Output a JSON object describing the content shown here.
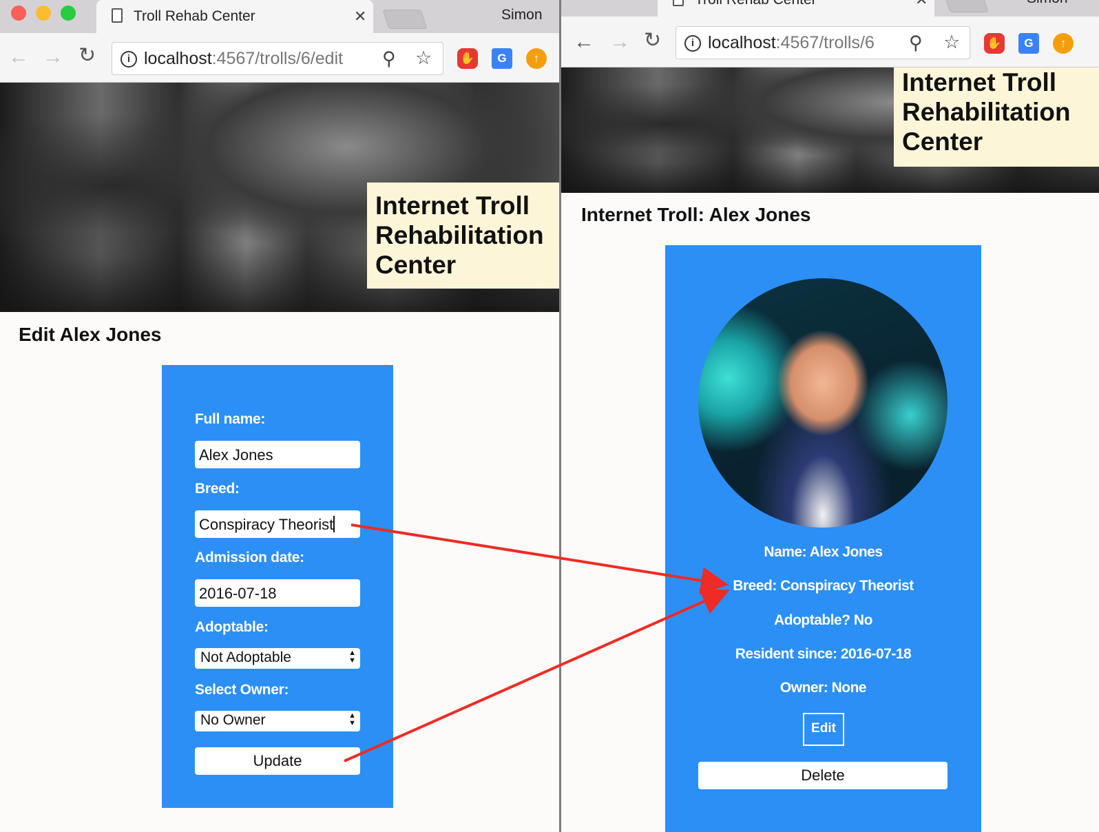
{
  "left_window": {
    "tab_title": "Troll Rehab Center",
    "profile_name": "Simon",
    "url_host": "localhost",
    "url_path": ":4567/trolls/6/edit",
    "brand_lines": [
      "Internet Troll",
      "Rehabilitation",
      "Center"
    ],
    "page_title": "Edit Alex Jones",
    "form": {
      "full_name_label": "Full name:",
      "full_name_value": "Alex Jones",
      "breed_label": "Breed:",
      "breed_value": "Conspiracy Theorist",
      "admission_label": "Admission date:",
      "admission_value": "2016-07-18",
      "adoptable_label": "Adoptable:",
      "adoptable_value": "Not Adoptable",
      "owner_label": "Select Owner:",
      "owner_value": "No Owner",
      "update_label": "Update"
    }
  },
  "right_window": {
    "tab_title": "Troll Rehab Center",
    "profile_name": "Simon",
    "url_host": "localhost",
    "url_path": ":4567/trolls/6",
    "brand_lines": [
      "Internet Troll",
      "Rehabilitation",
      "Center"
    ],
    "page_title": "Internet Troll: Alex Jones",
    "card": {
      "name_line": "Name: Alex Jones",
      "breed_line": "Breed: Conspiracy Theorist",
      "adoptable_line": "Adoptable? No",
      "resident_line": "Resident since: 2016-07-18",
      "owner_line": "Owner: None",
      "edit_label": "Edit",
      "delete_label": "Delete"
    }
  },
  "colors": {
    "panel_blue": "#2c8ff5",
    "brand_bg": "#fdf5d8",
    "annotation_red": "#ee2b24"
  }
}
